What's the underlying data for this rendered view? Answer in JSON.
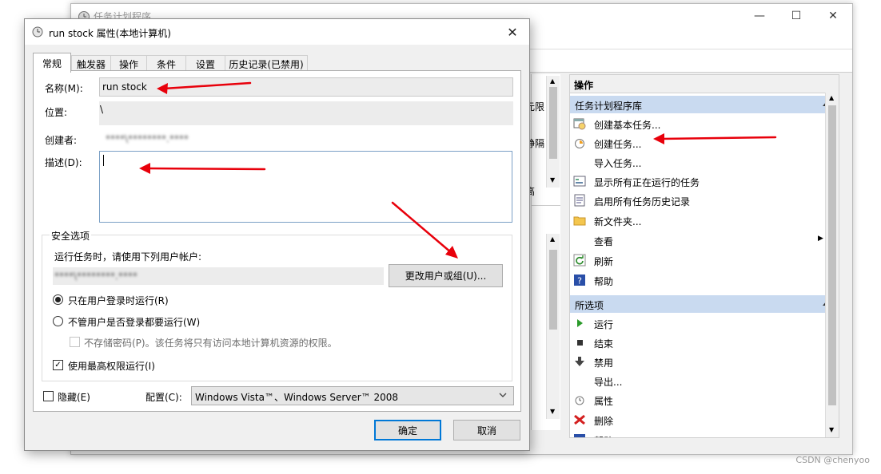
{
  "background_window": {
    "title": "任务计划程序",
    "controls": {
      "minimize": "—",
      "maximize": "☐",
      "close": "✕"
    },
    "partial_texts": [
      "元限",
      "静隔",
      "高"
    ]
  },
  "actions_panel": {
    "header": "操作",
    "sections": [
      {
        "title": "任务计划程序库",
        "items": [
          {
            "label": "创建基本任务...",
            "icon": "calendar-wizard-icon"
          },
          {
            "label": "创建任务...",
            "icon": "clock-task-icon"
          },
          {
            "label": "导入任务...",
            "icon": "none"
          },
          {
            "label": "显示所有正在运行的任务",
            "icon": "running-tasks-icon"
          },
          {
            "label": "启用所有任务历史记录",
            "icon": "history-icon"
          },
          {
            "label": "新文件夹...",
            "icon": "folder-icon"
          },
          {
            "label": "查看",
            "icon": "none",
            "submenu": true
          },
          {
            "label": "刷新",
            "icon": "refresh-icon"
          },
          {
            "label": "帮助",
            "icon": "help-icon"
          }
        ]
      },
      {
        "title": "所选项",
        "items": [
          {
            "label": "运行",
            "icon": "play-icon"
          },
          {
            "label": "结束",
            "icon": "stop-icon"
          },
          {
            "label": "禁用",
            "icon": "disable-icon"
          },
          {
            "label": "导出...",
            "icon": "none"
          },
          {
            "label": "属性",
            "icon": "properties-icon"
          },
          {
            "label": "删除",
            "icon": "delete-icon"
          },
          {
            "label": "帮助",
            "icon": "help-icon"
          }
        ]
      }
    ]
  },
  "dialog": {
    "title": "run stock 属性(本地计算机)",
    "close": "✕",
    "tabs": [
      "常规",
      "触发器",
      "操作",
      "条件",
      "设置",
      "历史记录(已禁用)"
    ],
    "active_tab": "常规",
    "fields": {
      "name_label": "名称(M):",
      "name_value": "run stock",
      "location_label": "位置:",
      "location_value": "\\",
      "author_label": "创建者:",
      "author_value": "****\\********.****",
      "description_label": "描述(D):",
      "description_value": ""
    },
    "security": {
      "group_title": "安全选项",
      "run_as_label": "运行任务时，请使用下列用户帐户:",
      "account_value": "****\\********.****",
      "change_user_button": "更改用户或组(U)...",
      "radio_logged_on": "只在用户登录时运行(R)",
      "radio_logged_on_selected": true,
      "radio_whether_logged": "不管用户是否登录都要运行(W)",
      "radio_whether_logged_selected": false,
      "no_store_password": "不存储密码(P)。该任务将只有访问本地计算机资源的权限。",
      "highest_privileges": "使用最高权限运行(I)",
      "highest_privileges_checked": true
    },
    "hidden_label": "隐藏(E)",
    "hidden_checked": false,
    "config_label": "配置(C):",
    "config_value": "Windows Vista™、Windows Server™ 2008",
    "ok_button": "确定",
    "cancel_button": "取消"
  },
  "colors": {
    "annotation_arrow": "#e8000b",
    "section_header_bg": "#c9daf0",
    "default_button_border": "#0078d7"
  },
  "watermark": "CSDN @chenyoo"
}
